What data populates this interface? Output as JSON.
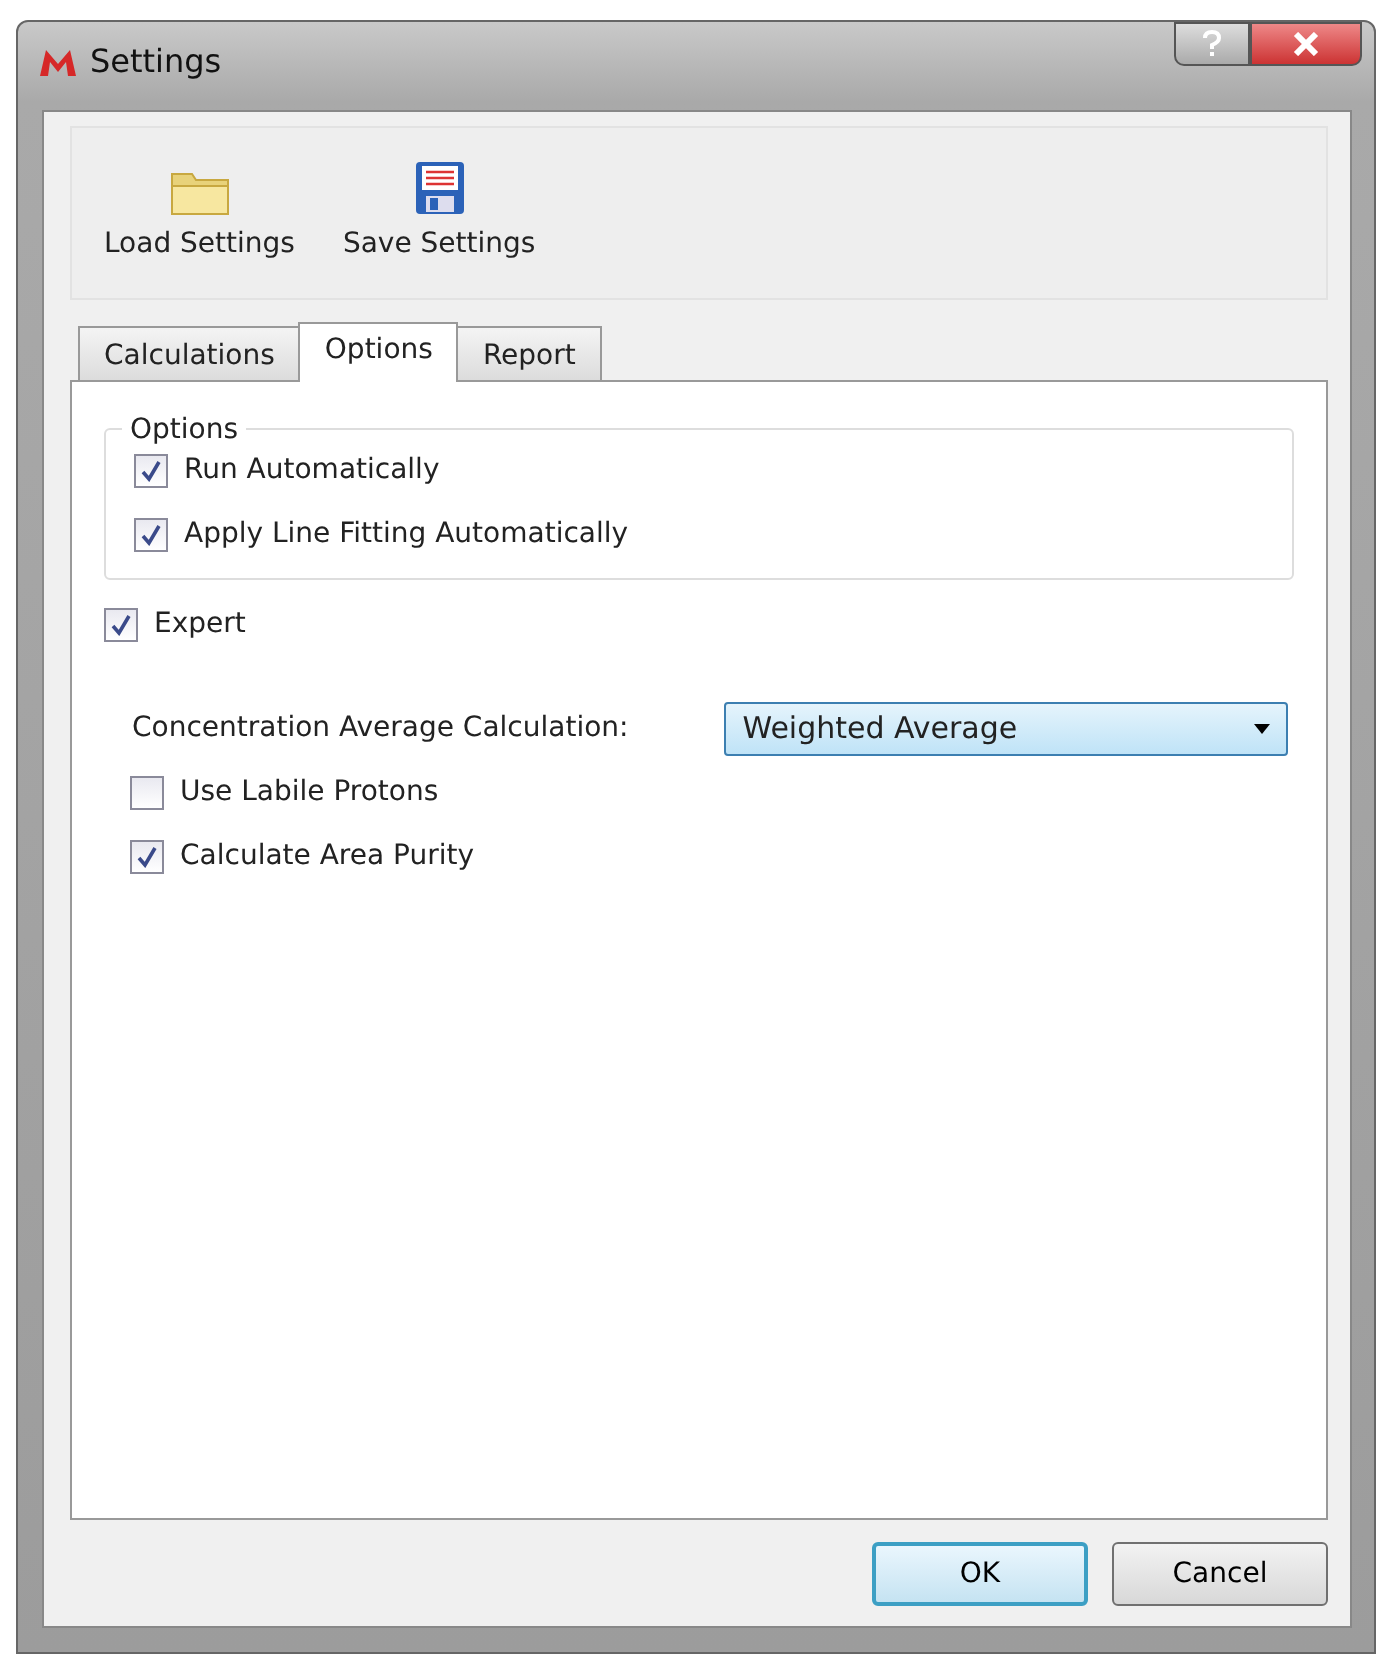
{
  "window": {
    "title": "Settings"
  },
  "toolbar": [
    {
      "kind": "folder",
      "label": "Load Settings"
    },
    {
      "kind": "disk",
      "label": "Save Settings"
    }
  ],
  "tabs": [
    {
      "label": "Calculations",
      "selected": false
    },
    {
      "label": "Options",
      "selected": true
    },
    {
      "label": "Report",
      "selected": false
    }
  ],
  "options_group": {
    "title": "Options",
    "items": [
      {
        "label": "Run Automatically",
        "checked": true
      },
      {
        "label": "Apply Line Fitting Automatically",
        "checked": true
      }
    ]
  },
  "expert": {
    "label": "Expert",
    "checked": true
  },
  "concentration": {
    "label": "Concentration Average Calculation:",
    "value": "Weighted Average"
  },
  "expert_items": [
    {
      "label": "Use Labile Protons",
      "checked": false
    },
    {
      "label": "Calculate Area Purity",
      "checked": true
    }
  ],
  "buttons": [
    {
      "label": "OK",
      "default": true
    },
    {
      "label": "Cancel",
      "default": false
    }
  ]
}
